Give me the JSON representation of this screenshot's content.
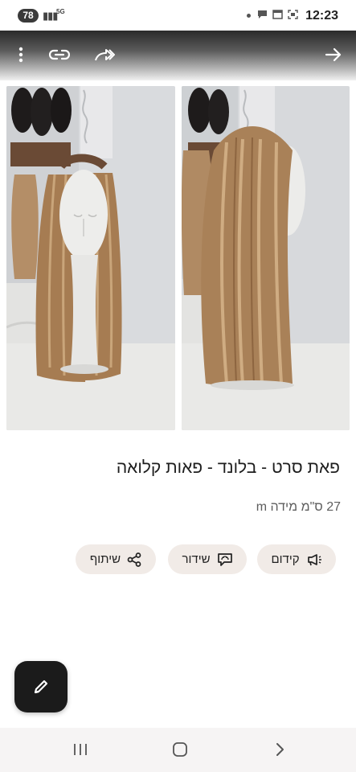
{
  "status_bar": {
    "battery": "78",
    "network": "5G",
    "time": "12:23"
  },
  "header": {
    "icons": [
      "more-vert-icon",
      "link-icon",
      "share-arrow-icon",
      "back-arrow-icon"
    ]
  },
  "listing": {
    "images": [
      "wig-front-view",
      "wig-side-view"
    ],
    "title": "פאת סרט - בלונד - פאות קלואה",
    "details": "27 ס\"מ מידה m"
  },
  "actions": [
    {
      "label": "קידום",
      "icon": "megaphone-icon"
    },
    {
      "label": "שידור",
      "icon": "broadcast-icon"
    },
    {
      "label": "שיתוף",
      "icon": "share-icon"
    }
  ],
  "fab": {
    "icon": "pencil-icon"
  },
  "nav": {
    "icons": [
      "recents-icon",
      "home-icon",
      "back-icon"
    ]
  },
  "colors": {
    "header_top": "#2a2a2a",
    "chip_bg": "#f1ebe7",
    "fab_bg": "#1b1b1b",
    "navbar_bg": "#f6f4f4"
  }
}
